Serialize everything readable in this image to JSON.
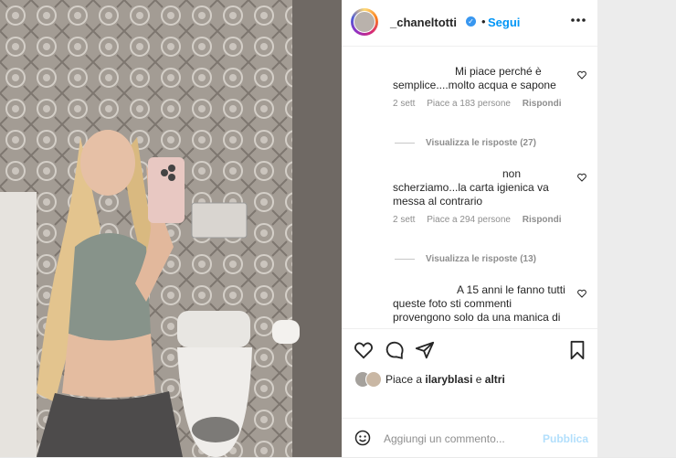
{
  "post": {
    "username": "_chaneltotti",
    "verified_symbol": "✓",
    "dot": "•",
    "follow_label": "Segui",
    "more_icon": "more-icon"
  },
  "comments": [
    {
      "text_lines": [
        "Mi piace perché è",
        "semplice....molto acqua e sapone"
      ],
      "time": "2 sett",
      "likes": "Piace a 183 persone",
      "reply": "Rispondi",
      "view_replies": "Visualizza le risposte (27)"
    },
    {
      "text_lines": [
        "non",
        "scherziamo...la carta igienica va",
        "messa al contrario"
      ],
      "time": "2 sett",
      "likes": "Piace a 294 persone",
      "reply": "Rispondi",
      "view_replies": "Visualizza le risposte (13)"
    },
    {
      "text_lines": [
        "A 15 anni le fanno tutti",
        "queste foto sti commenti",
        "provengono solo da una manica di"
      ]
    }
  ],
  "likes_line": {
    "prefix": "Piace a",
    "user": "ilaryblasi",
    "joiner": "e",
    "others": "altri"
  },
  "add_comment": {
    "placeholder": "Aggiungi un commento...",
    "publish_label": "Pubblica"
  },
  "colors": {
    "accent": "#0095f6",
    "text": "#262626",
    "muted": "#8e8e8e"
  }
}
